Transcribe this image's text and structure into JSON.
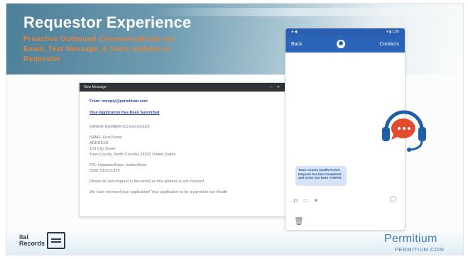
{
  "slide": {
    "title": "Requestor Experience",
    "subtitle_line1": "Proactive Outbound Communications via",
    "subtitle_line2": "Email, Text Message, & Voice updates to",
    "subtitle_line3": "Requester"
  },
  "email": {
    "window_title": "New Message",
    "window_controls": "— ✕",
    "from": "From: noreply@permitium.com",
    "subject": "Your Application Has Been Submitted",
    "order_heading": "ORDER NUMBER C3-XXXXXXXX",
    "lines": [
      "NAME: First Name",
      "ADDRESS",
      "123 City Street",
      "Town County, North Carolina 28202 United States",
      "",
      "P/E: Hispanic/Asian, Indian/Amer",
      "DOB: 01/01/1970",
      "",
      "Please do not respond to this email as this address is not checked",
      "",
      "We have received your application! Your application to for a permit to our Health"
    ]
  },
  "phone": {
    "status_left": "●  ◀",
    "status_right": "▾ ▮ 1:00",
    "nav_back": "Back",
    "nav_contacts": "Contacts",
    "sms_text": "Town County Health Permit Request has this Completed and Order has been ##SPHS",
    "tools": [
      "◘",
      "▭",
      "♥"
    ]
  },
  "footer": {
    "logo_line1": "ital",
    "logo_line2": "Records",
    "brand": "Permitium",
    "brand_url": "PERMITIUM.COM"
  },
  "colors": {
    "title": "#ffffff",
    "subtitle": "#e8833a",
    "brand_blue": "#3e7bb3",
    "phone_header": "#2a63b8",
    "headset_blue": "#1f5faa",
    "headset_red": "#e24b2d"
  },
  "icons": [
    "chat-headset-icon",
    "trash-icon",
    "vital-records-logo-icon",
    "camera-icon",
    "attach-icon",
    "heart-icon",
    "send-icon",
    "avatar-icon"
  ]
}
